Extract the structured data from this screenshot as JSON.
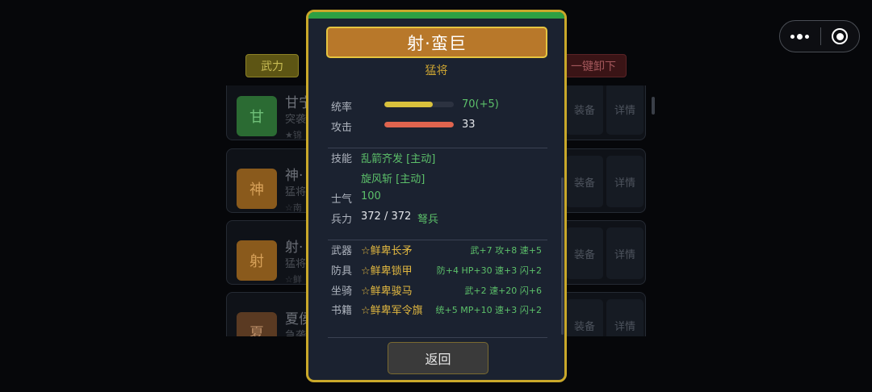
{
  "background": {
    "tabs": {
      "force_label": "武力",
      "unload_label": "一键卸下"
    },
    "cards": [
      {
        "badge": "甘",
        "name": "甘宁",
        "sub": "突袭",
        "sub2": "★锦",
        "badge_color": "#2b6b33",
        "badge_text": "#6fbf78"
      },
      {
        "badge": "神",
        "name": "神·",
        "sub": "猛将",
        "sub2": "☆南",
        "badge_color": "#8a5a1c",
        "badge_text": "#d8a25a"
      },
      {
        "badge": "射",
        "name": "射·",
        "sub": "猛将",
        "sub2": "☆鲜",
        "badge_color": "#8a5a1c",
        "badge_text": "#d8a25a"
      },
      {
        "badge": "夏",
        "name": "夏侯",
        "sub": "急袭",
        "sub2": "",
        "badge_color": "#5a3a22",
        "badge_text": "#b98c66"
      }
    ],
    "equip_label": "装备",
    "detail_label": "详情"
  },
  "capsule": {
    "more_icon": "more-dots-icon",
    "close_icon": "record-circle-icon"
  },
  "modal": {
    "title": "射·蛮巨",
    "rank": "猛将",
    "stats": [
      {
        "label": "统率",
        "value": "70(+5)",
        "fraction": 0.7,
        "color": "#d9c13c"
      },
      {
        "label": "攻击",
        "value": "33",
        "fraction": 1.0,
        "color": "#e0644e"
      }
    ],
    "skills_label": "技能",
    "skills": [
      "乱箭齐发 [主动]",
      "旋风斩 [主动]"
    ],
    "morale_label": "士气",
    "morale_value": "100",
    "troops_label": "兵力",
    "troops_value": "372 / 372",
    "troop_type": "弩兵",
    "equipment": [
      {
        "slot": "武器",
        "name": "☆鲜卑长矛",
        "stats": "武+7 攻+8 速+5"
      },
      {
        "slot": "防具",
        "name": "☆鲜卑锁甲",
        "stats": "防+4 HP+30 速+3 闪+2"
      },
      {
        "slot": "坐骑",
        "name": "☆鲜卑骏马",
        "stats": "武+2 速+20 闪+6"
      },
      {
        "slot": "书籍",
        "name": "☆鲜卑军令旗",
        "stats": "统+5 MP+10 速+3 闪+2"
      }
    ],
    "back_label": "返回"
  }
}
